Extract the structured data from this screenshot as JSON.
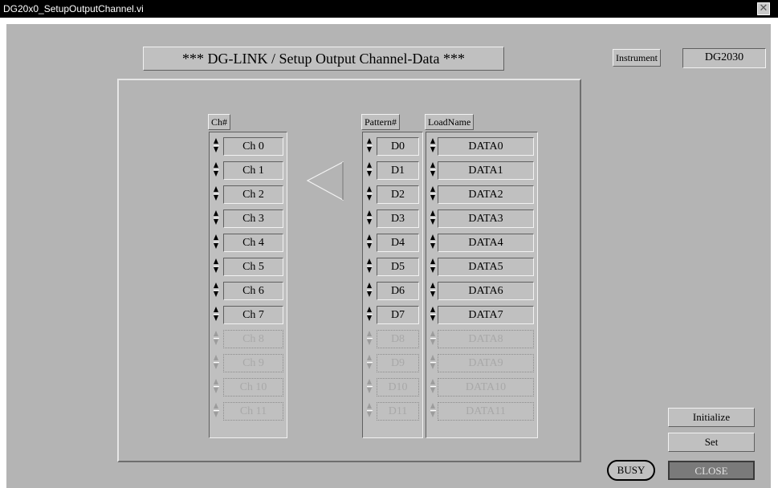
{
  "window": {
    "title": "DG20x0_SetupOutputChannel.vi",
    "close_glyph": "✕"
  },
  "panel_title": "*** DG-LINK / Setup Output Channel-Data ***",
  "instrument": {
    "label": "Instrument",
    "value": "DG2030"
  },
  "columns": {
    "channel": "Ch#",
    "pattern": "Pattern#",
    "loadname": "LoadName"
  },
  "arrow_icon": "left-triangle-icon",
  "rows": [
    {
      "ch": "Ch 0",
      "pattern": "D0",
      "load": "DATA0",
      "enabled": true
    },
    {
      "ch": "Ch 1",
      "pattern": "D1",
      "load": "DATA1",
      "enabled": true
    },
    {
      "ch": "Ch 2",
      "pattern": "D2",
      "load": "DATA2",
      "enabled": true
    },
    {
      "ch": "Ch 3",
      "pattern": "D3",
      "load": "DATA3",
      "enabled": true
    },
    {
      "ch": "Ch 4",
      "pattern": "D4",
      "load": "DATA4",
      "enabled": true
    },
    {
      "ch": "Ch 5",
      "pattern": "D5",
      "load": "DATA5",
      "enabled": true
    },
    {
      "ch": "Ch 6",
      "pattern": "D6",
      "load": "DATA6",
      "enabled": true
    },
    {
      "ch": "Ch 7",
      "pattern": "D7",
      "load": "DATA7",
      "enabled": true
    },
    {
      "ch": "Ch 8",
      "pattern": "D8",
      "load": "DATA8",
      "enabled": false
    },
    {
      "ch": "Ch 9",
      "pattern": "D9",
      "load": "DATA9",
      "enabled": false
    },
    {
      "ch": "Ch 10",
      "pattern": "D10",
      "load": "DATA10",
      "enabled": false
    },
    {
      "ch": "Ch 11",
      "pattern": "D11",
      "load": "DATA11",
      "enabled": false
    }
  ],
  "buttons": {
    "initialize": "Initialize",
    "set": "Set",
    "close": "CLOSE"
  },
  "busy_indicator": "BUSY",
  "colors": {
    "panel_bg": "#b4b4b4",
    "close_button_bg": "#7a7a7a",
    "titlebar_bg": "#000000"
  }
}
